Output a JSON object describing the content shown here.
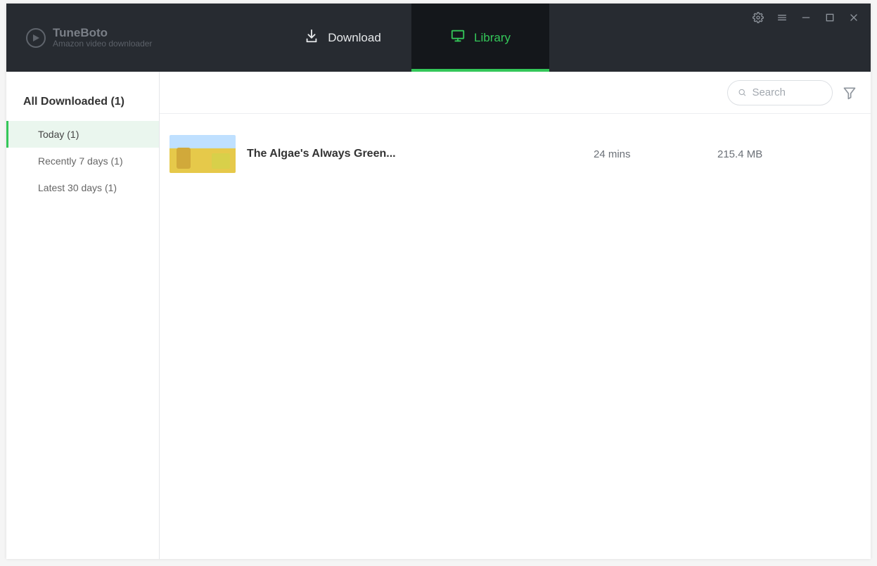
{
  "brand": {
    "name": "TuneBoto",
    "subtitle": "Amazon video downloader"
  },
  "nav": {
    "download": "Download",
    "library": "Library",
    "active": "library"
  },
  "window_icons": {
    "settings": "gear-icon",
    "menu": "menu-icon",
    "minimize": "minimize-icon",
    "maximize": "maximize-icon",
    "close": "close-icon"
  },
  "sidebar": {
    "header": "All Downloaded (1)",
    "items": [
      {
        "label": "Today (1)",
        "active": true
      },
      {
        "label": "Recently 7 days (1)",
        "active": false
      },
      {
        "label": "Latest 30 days (1)",
        "active": false
      }
    ]
  },
  "toolbar": {
    "search_placeholder": "Search",
    "search_value": ""
  },
  "library": {
    "rows": [
      {
        "title": "The Algae's Always Green...",
        "duration": "24 mins",
        "size": "215.4 MB"
      }
    ]
  },
  "colors": {
    "accent": "#34c759",
    "header_bg": "#272b31",
    "header_active_bg": "#14171b"
  }
}
